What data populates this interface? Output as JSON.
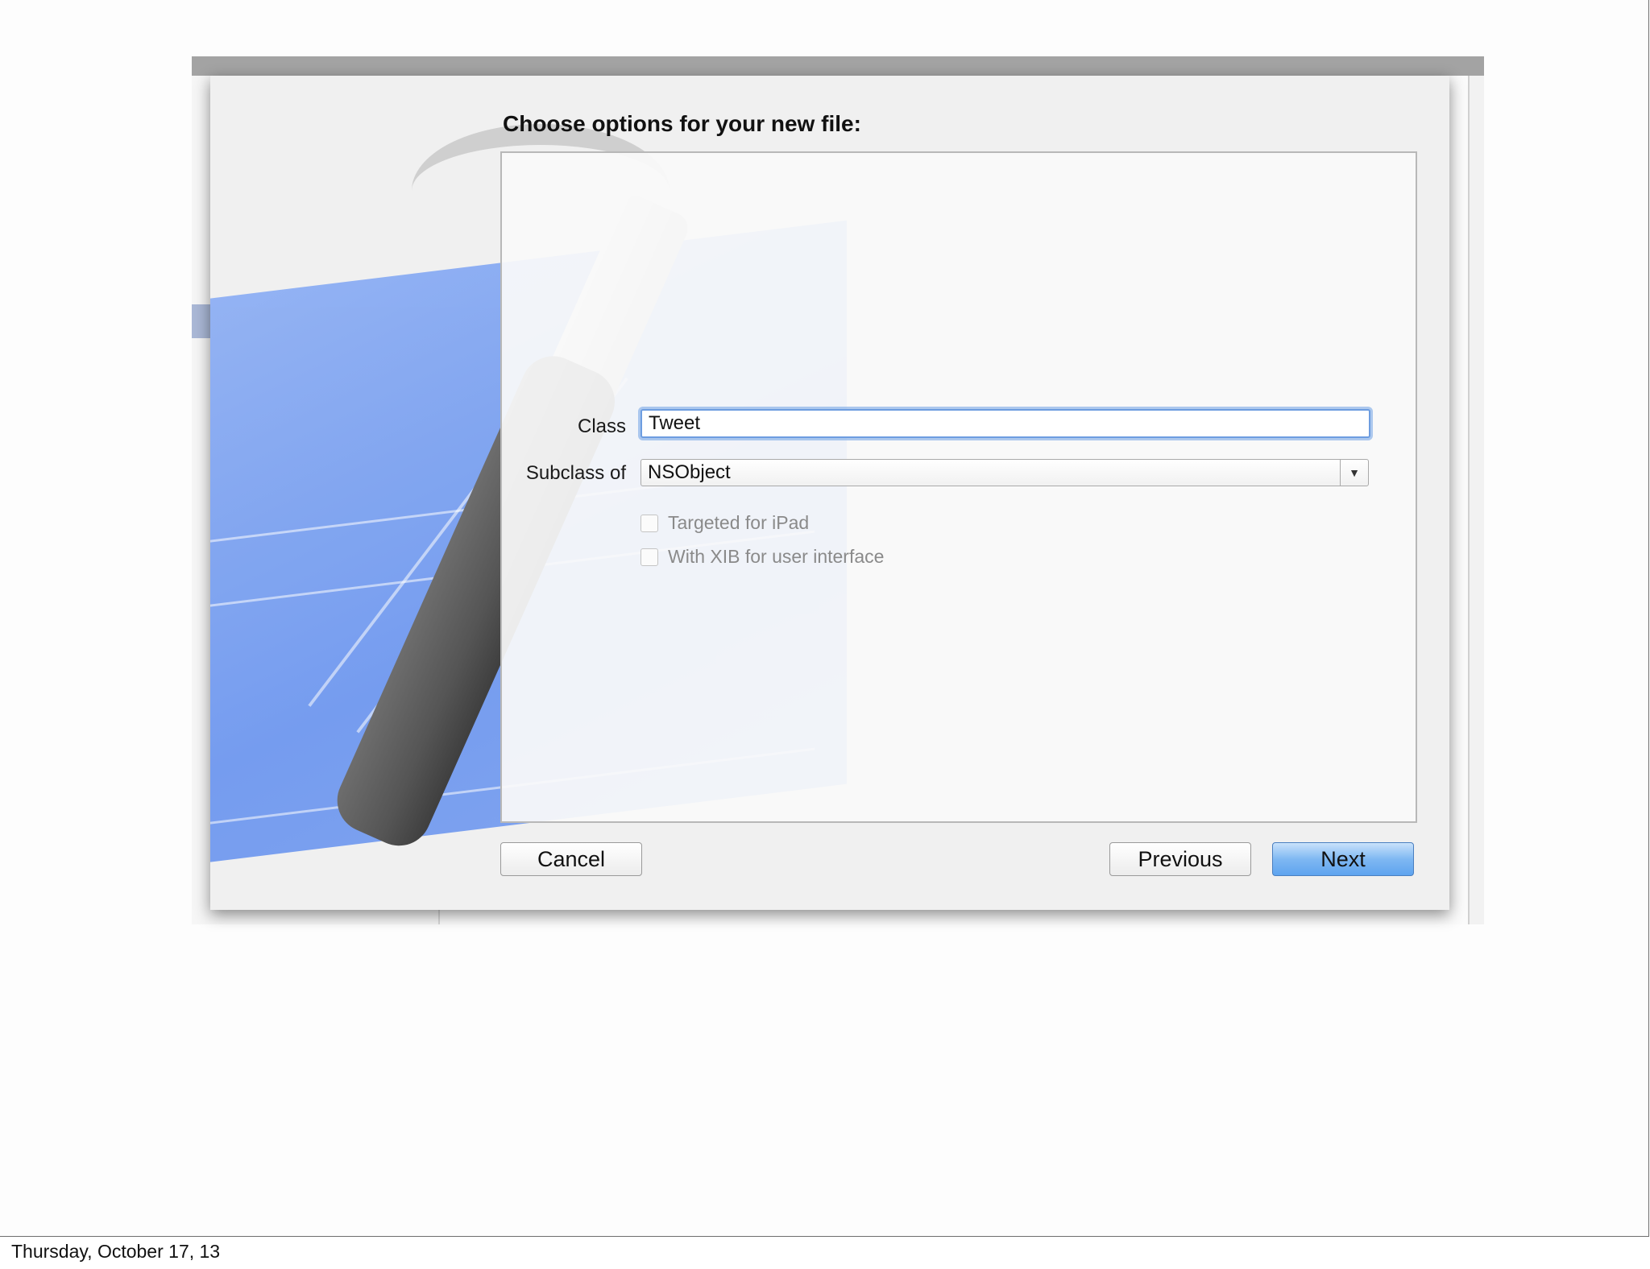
{
  "dialog": {
    "title": "Choose options for your new file:",
    "class_label": "Class",
    "class_value": "Tweet",
    "subclass_label": "Subclass of",
    "subclass_value": "NSObject",
    "checkboxes": [
      {
        "label": "Targeted for iPad",
        "checked": false
      },
      {
        "label": "With XIB for user interface",
        "checked": false
      }
    ],
    "buttons": {
      "cancel": "Cancel",
      "previous": "Previous",
      "next": "Next"
    },
    "colors": {
      "primary_button": "#6aaaf0",
      "focus_ring": "#6d9de0"
    }
  },
  "footer": {
    "date": "Thursday, October 17, 13"
  }
}
